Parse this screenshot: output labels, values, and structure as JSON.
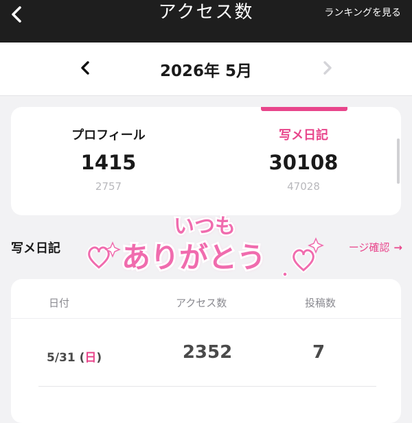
{
  "header": {
    "back_icon": "chevron-left-icon",
    "title": "アクセス数",
    "ranking_link": "ランキングを見る"
  },
  "month_nav": {
    "prev_icon": "chevron-left-icon",
    "label": "2026年 5月",
    "next_icon": "chevron-right-icon",
    "next_disabled": true
  },
  "summary": {
    "profile": {
      "label": "プロフィール",
      "value": "1415",
      "sub": "2757"
    },
    "photo_diary": {
      "label": "写メ日記",
      "value": "30108",
      "sub": "47028",
      "selected": true
    }
  },
  "section": {
    "title": "写メ日記",
    "link": "ージ確認",
    "link_arrow": "→"
  },
  "table": {
    "headers": [
      "日付",
      "アクセス数",
      "投稿数"
    ],
    "rows": [
      {
        "date": "5/31",
        "dow_open": " (",
        "dow": "日",
        "dow_close": ")",
        "access": "2352",
        "posts": "7"
      }
    ]
  },
  "sticker": {
    "line1": "いつも",
    "line2": "ありがとう"
  },
  "colors": {
    "accent": "#e8458b",
    "header_bg": "#1e1e1e",
    "page_bg": "#f2f2f4",
    "sticker_fill": "#f06cae"
  }
}
